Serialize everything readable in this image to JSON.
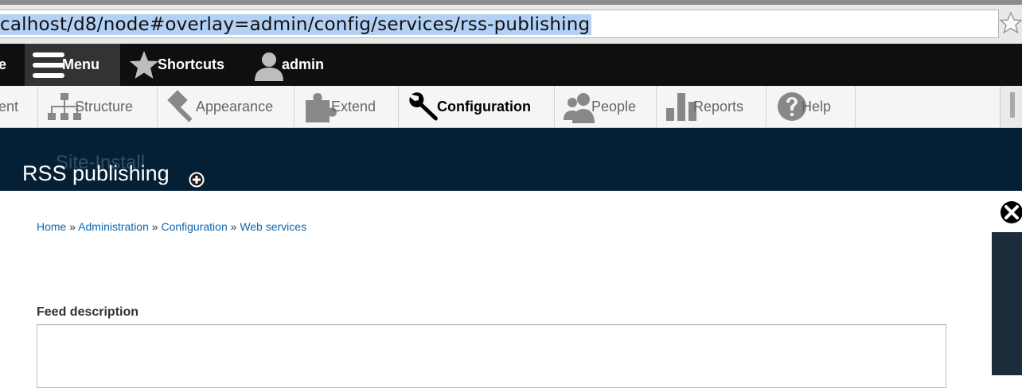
{
  "browser": {
    "url": "calhost/d8/node#overlay=admin/config/services/rss-publishing"
  },
  "toolbar": {
    "home_label": "e",
    "menu_label": "Menu",
    "shortcuts_label": "Shortcuts",
    "user_label": "admin"
  },
  "tray": {
    "items": [
      {
        "label": "ent",
        "icon": "content-icon"
      },
      {
        "label": "Structure",
        "icon": "structure-icon"
      },
      {
        "label": "Appearance",
        "icon": "appearance-icon"
      },
      {
        "label": "Extend",
        "icon": "extend-icon"
      },
      {
        "label": "Configuration",
        "icon": "wrench-icon",
        "active": true
      },
      {
        "label": "People",
        "icon": "people-icon"
      },
      {
        "label": "Reports",
        "icon": "reports-icon"
      },
      {
        "label": "Help",
        "icon": "help-icon"
      }
    ]
  },
  "overlay": {
    "site_name": "Site-Install",
    "title": "RSS publishing"
  },
  "breadcrumb": {
    "items": [
      "Home",
      "Administration",
      "Configuration",
      "Web services"
    ],
    "separator": "»"
  },
  "form": {
    "feed_description_label": "Feed description",
    "feed_description_value": ""
  },
  "colors": {
    "link": "#0b66b1",
    "header_bg": "#052035",
    "toolbar_bg": "#0f0f0f",
    "selection": "#b3d0f5"
  }
}
